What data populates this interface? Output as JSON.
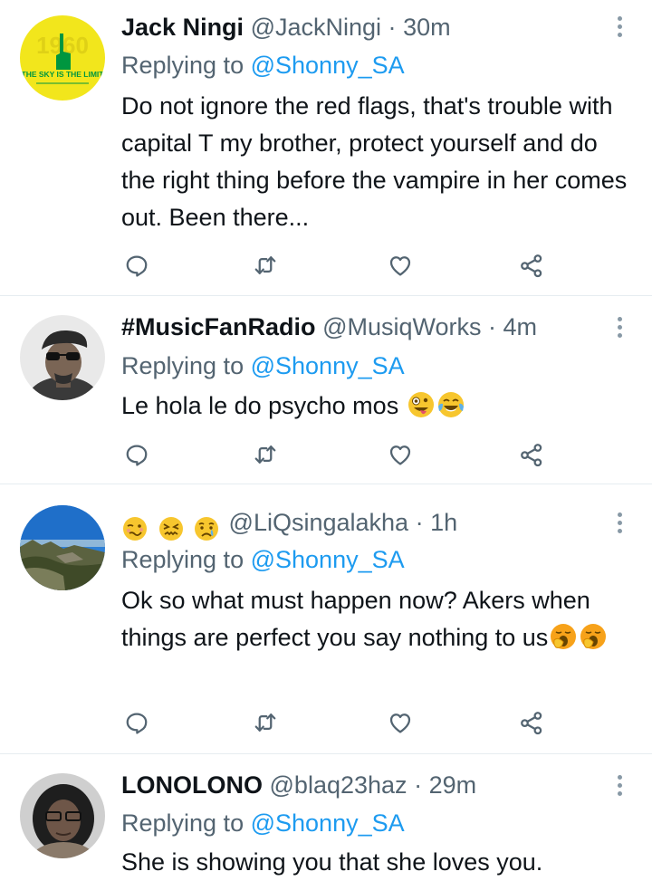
{
  "tweets": [
    {
      "name": "Jack Ningi",
      "handle": "@JackNingi",
      "dot": "·",
      "time": "30m",
      "replying_prefix": "Replying to",
      "replying_to": "@Shonny_SA",
      "body": "Do not ignore the red flags, that's trouble with capital T my brother, protect yourself and do the right thing before the vampire in her comes out. Been there...",
      "avatar_text": "THE SKY IS THE LIMIT",
      "avatar_logo_text": "1960"
    },
    {
      "name": "#MusicFanRadio",
      "handle": "@MusiqWorks",
      "dot": "·",
      "time": "4m",
      "replying_prefix": "Replying to",
      "replying_to": "@Shonny_SA",
      "body": "Le hola le do psycho mos"
    },
    {
      "name": "",
      "name_emojis": [
        "woozy-face-emoji",
        "confounded-face-emoji",
        "crying-face-emoji"
      ],
      "handle": "@LiQsingalakha",
      "dot": "·",
      "time": "1h",
      "replying_prefix": "Replying to",
      "replying_to": "@Shonny_SA",
      "body": "Ok so what must happen now? Akers when things are perfect you say nothing to us"
    },
    {
      "name": "LONOLONO",
      "handle": "@blaq23haz",
      "dot": "·",
      "time": "29m",
      "replying_prefix": "Replying to",
      "replying_to": "@Shonny_SA",
      "body": "She is showing you that she loves you."
    }
  ],
  "icons": {
    "reply": "reply-icon",
    "retweet": "retweet-icon",
    "like": "like-icon",
    "share": "share-icon",
    "more": "more-options-icon"
  },
  "colors": {
    "link": "#1d9bf0",
    "secondary": "#536471",
    "icon": "#536471",
    "divider": "#e6ecf0",
    "avatar_green": "#00963f",
    "avatar_yellow": "#f2e61c"
  }
}
